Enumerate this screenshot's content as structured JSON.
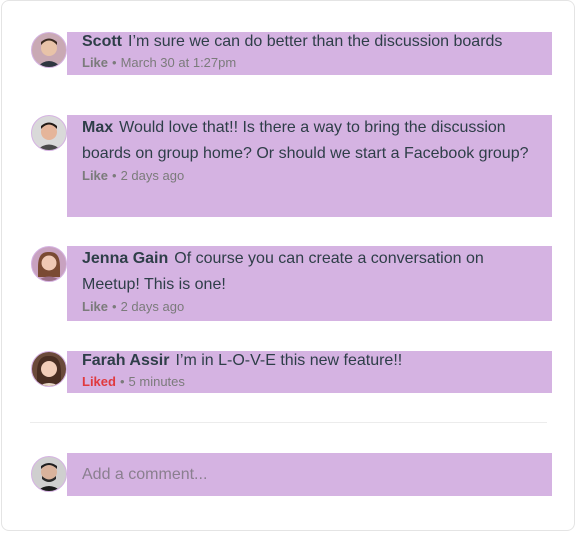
{
  "comments": [
    {
      "author": "Scott",
      "text": "I’m sure we can do better than the discussion boards",
      "like_label": "Like",
      "liked": false,
      "time": "March 30 at 1:27pm",
      "avatar_icon": "user-avatar-scott"
    },
    {
      "author": "Max",
      "text": "Would love that!! Is there a way to bring the discussion boards on group home? Or should we start a Facebook group?",
      "like_label": "Like",
      "liked": false,
      "time": "2 days ago",
      "avatar_icon": "user-avatar-max"
    },
    {
      "author": "Jenna Gain",
      "text": "Of course you can create a conversation on Meetup! This is one!",
      "like_label": "Like",
      "liked": false,
      "time": "2 days ago",
      "avatar_icon": "user-avatar-jenna"
    },
    {
      "author": "Farah Assir",
      "text": "I’m in L-O-V-E this new feature!!",
      "like_label": "Liked",
      "liked": true,
      "time": "5 minutes",
      "avatar_icon": "user-avatar-farah"
    }
  ],
  "composer": {
    "placeholder": "Add a comment...",
    "avatar_icon": "current-user-avatar"
  },
  "colors": {
    "highlight": "#d5b3e2",
    "text": "#2e3e48",
    "meta": "#7b7b7b",
    "liked": "#e0393e"
  },
  "separator": "•"
}
